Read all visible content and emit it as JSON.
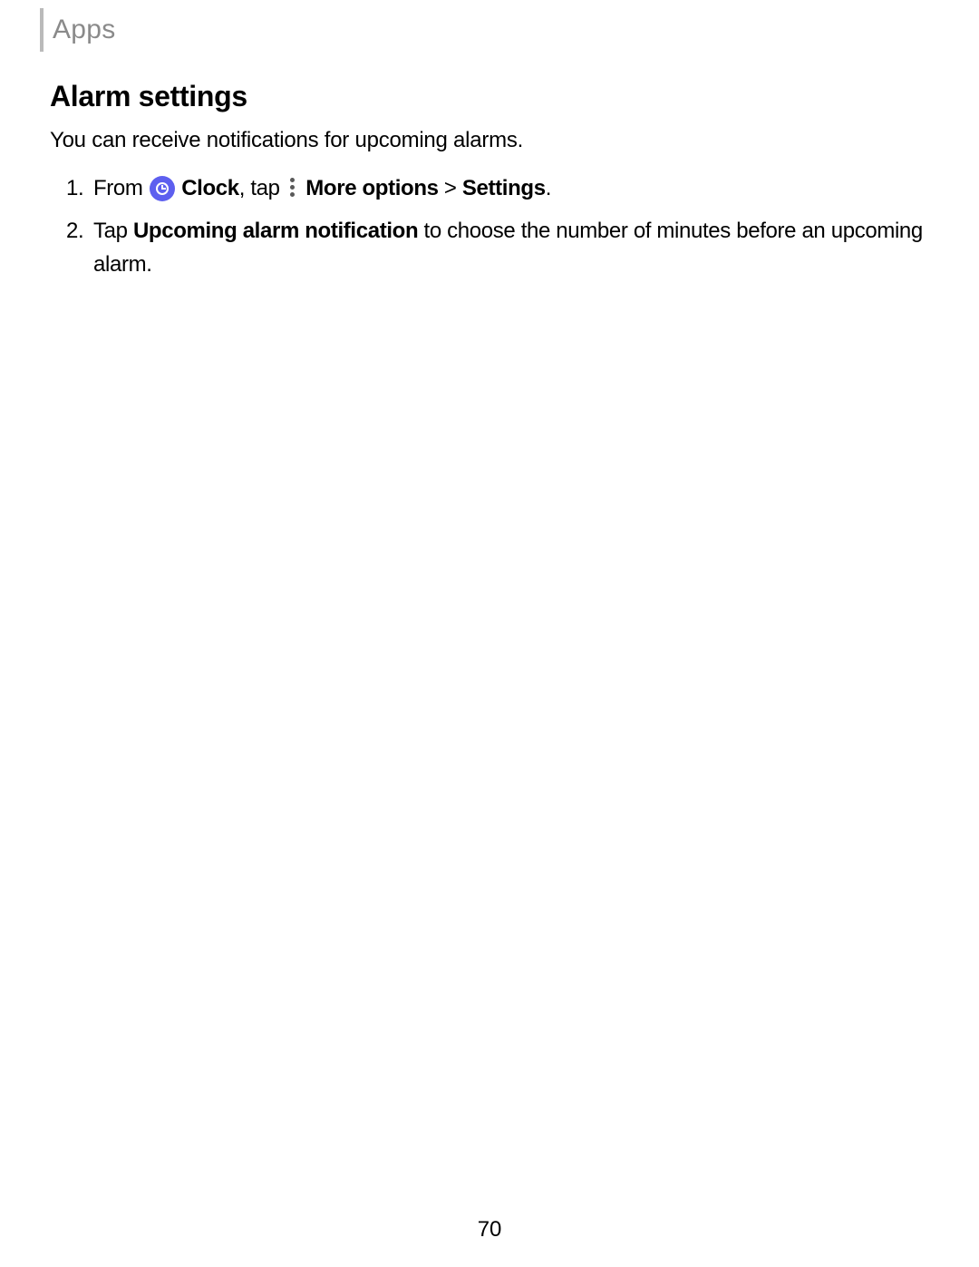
{
  "header": {
    "title": "Apps"
  },
  "section": {
    "title": "Alarm settings",
    "intro": "You can receive notifications for upcoming alarms."
  },
  "steps": [
    {
      "number": "1.",
      "parts": {
        "from": "From ",
        "clock": "Clock",
        "tap": ", tap ",
        "more_options": "More options",
        "gt": " > ",
        "settings": "Settings",
        "period": "."
      }
    },
    {
      "number": "2.",
      "parts": {
        "tap": "Tap ",
        "upcoming": "Upcoming alarm notification",
        "rest": " to choose the number of minutes before an upcoming alarm."
      }
    }
  ],
  "page_number": "70"
}
